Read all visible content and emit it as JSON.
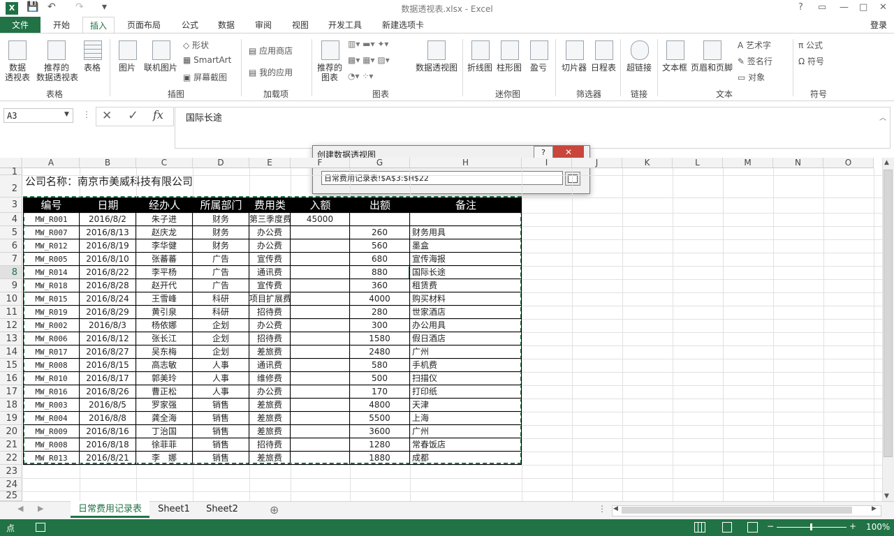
{
  "window": {
    "title": "数据透视表.xlsx - Excel",
    "login": "登录",
    "app_icon": "X",
    "help": "?",
    "restore": "▭",
    "minimize": "—",
    "maximize": "□",
    "close": "✕"
  },
  "quick_access": {
    "save": "💾",
    "undo": "↶",
    "redo": "↷",
    "customize": "▾"
  },
  "tabs": [
    "文件",
    "开始",
    "插入",
    "页面布局",
    "公式",
    "数据",
    "审阅",
    "视图",
    "开发工具",
    "新建选项卡"
  ],
  "ribbon": {
    "pivot_table": "数据\n透视表",
    "recommended_pivot": "推荐的\n数据透视表",
    "table": "表格",
    "group_tables": "表格",
    "picture": "图片",
    "online_picture": "联机图片",
    "shapes": "形状",
    "smartart": "SmartArt",
    "screenshot": "屏幕截图",
    "group_illustrations": "插图",
    "app_store": "应用商店",
    "my_apps": "我的应用",
    "group_addins": "加载项",
    "recommended_charts": "推荐的\n图表",
    "pivot_chart": "数据透视图",
    "group_charts": "图表",
    "line": "折线图",
    "column": "柱形图",
    "winloss": "盈亏",
    "group_sparklines": "迷你图",
    "slicer": "切片器",
    "timeline": "日程表",
    "group_filters": "筛选器",
    "hyperlink": "超链接",
    "group_links": "链接",
    "textbox": "文本框",
    "header_footer": "页眉和页脚",
    "wordart": "艺术字",
    "signature": "签名行",
    "object": "对象",
    "group_text": "文本",
    "equation": "公式",
    "symbol": "符号",
    "group_symbols": "符号"
  },
  "formula_bar": {
    "name_box": "A3",
    "cancel": "✕",
    "confirm": "✓",
    "fx": "fx",
    "content": "国际长途"
  },
  "columns": [
    "A",
    "B",
    "C",
    "D",
    "E",
    "F",
    "G",
    "H",
    "I",
    "J",
    "K",
    "L",
    "M",
    "N",
    "O"
  ],
  "rows": [
    "1",
    "2",
    "3",
    "4",
    "5",
    "6",
    "7",
    "8",
    "9",
    "10",
    "11",
    "12",
    "13",
    "14",
    "15",
    "16",
    "17",
    "18",
    "19",
    "20",
    "21",
    "22",
    "23",
    "24",
    "25"
  ],
  "company": "公司名称：南京市美威科技有限公司",
  "headers": [
    "编号",
    "日期",
    "经办人",
    "所属部门",
    "费用类别",
    "入额",
    "出额",
    "备注"
  ],
  "data_rows": [
    [
      "MW_R001",
      "2016/8/2",
      "朱子进",
      "财务",
      "第三季度费",
      "45000",
      "",
      ""
    ],
    [
      "MW_R007",
      "2016/8/13",
      "赵庆龙",
      "财务",
      "办公费",
      "",
      "260",
      "财务用具"
    ],
    [
      "MW_R012",
      "2016/8/19",
      "李华健",
      "财务",
      "办公费",
      "",
      "560",
      "墨盒"
    ],
    [
      "MW_R005",
      "2016/8/10",
      "张蕃蕃",
      "广告",
      "宣传费",
      "",
      "680",
      "宣传海报"
    ],
    [
      "MW_R014",
      "2016/8/22",
      "李平杨",
      "广告",
      "通讯费",
      "",
      "880",
      "国际长途"
    ],
    [
      "MW_R018",
      "2016/8/28",
      "赵开代",
      "广告",
      "宣传费",
      "",
      "360",
      "租赁费"
    ],
    [
      "MW_R015",
      "2016/8/24",
      "王雪峰",
      "科研",
      "项目扩展费",
      "",
      "4000",
      "购买材料"
    ],
    [
      "MW_R019",
      "2016/8/29",
      "黄引泉",
      "科研",
      "招待费",
      "",
      "280",
      "世家酒店"
    ],
    [
      "MW_R002",
      "2016/8/3",
      "杨依娜",
      "企划",
      "办公费",
      "",
      "300",
      "办公用具"
    ],
    [
      "MW_R006",
      "2016/8/12",
      "张长江",
      "企划",
      "招待费",
      "",
      "1580",
      "假日酒店"
    ],
    [
      "MW_R017",
      "2016/8/27",
      "吴东梅",
      "企划",
      "差旅费",
      "",
      "2480",
      "广州"
    ],
    [
      "MW_R008",
      "2016/8/15",
      "高志敏",
      "人事",
      "通讯费",
      "",
      "580",
      "手机费"
    ],
    [
      "MW_R010",
      "2016/8/17",
      "郭美玲",
      "人事",
      "维修费",
      "",
      "500",
      "扫描仪"
    ],
    [
      "MW_R016",
      "2016/8/26",
      "曹正松",
      "人事",
      "办公费",
      "",
      "170",
      "打印纸"
    ],
    [
      "MW_R003",
      "2016/8/5",
      "罗家强",
      "销售",
      "差旅费",
      "",
      "4800",
      "天津"
    ],
    [
      "MW_R004",
      "2016/8/8",
      "龚全海",
      "销售",
      "差旅费",
      "",
      "5500",
      "上海"
    ],
    [
      "MW_R009",
      "2016/8/16",
      "丁治国",
      "销售",
      "差旅费",
      "",
      "3600",
      "广州"
    ],
    [
      "MW_R008",
      "2016/8/18",
      "徐菲菲",
      "销售",
      "招待费",
      "",
      "1280",
      "常春饭店"
    ],
    [
      "MW_R013",
      "2016/8/21",
      "李　娜",
      "销售",
      "差旅费",
      "",
      "1880",
      "成都"
    ]
  ],
  "dialog": {
    "title": "创建数据透视图",
    "help": "?",
    "close": "✕",
    "range": "日常费用记录表!$A$3:$H$22"
  },
  "sheet_tabs": [
    "日常费用记录表",
    "Sheet1",
    "Sheet2"
  ],
  "sheet_add": "⊕",
  "status": {
    "mode": "点",
    "zoom": "100%"
  }
}
